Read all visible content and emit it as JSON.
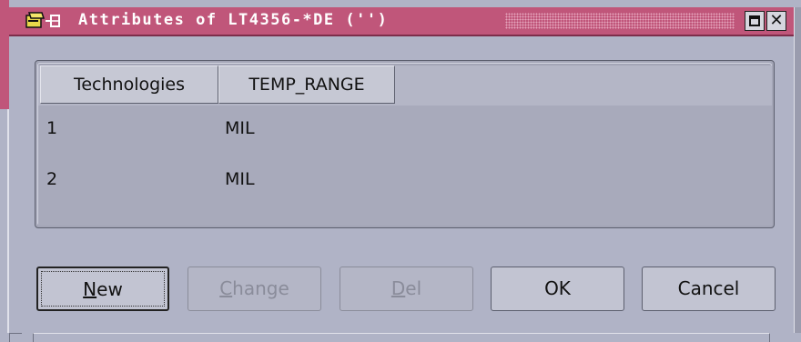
{
  "window": {
    "title": "Attributes of LT4356-*DE ('')",
    "controls": {
      "maximize_icon": "maximize-icon",
      "close_icon": "close-icon",
      "close_glyph": "✕"
    },
    "accent_color": "#c0567a"
  },
  "table": {
    "columns": [
      "Technologies",
      "TEMP_RANGE"
    ],
    "rows": [
      {
        "index": "1",
        "temp_range": "MIL"
      },
      {
        "index": "2",
        "temp_range": "MIL"
      }
    ]
  },
  "buttons": {
    "new": {
      "label": "New",
      "mnemonic": "N",
      "rest": "ew",
      "enabled": true,
      "focused": true
    },
    "change": {
      "label": "Change",
      "mnemonic": "C",
      "rest": "hange",
      "enabled": false
    },
    "del": {
      "label": "Del",
      "mnemonic": "D",
      "rest": "el",
      "enabled": false
    },
    "ok": {
      "label": "OK",
      "enabled": true
    },
    "cancel": {
      "label": "Cancel",
      "enabled": true
    }
  }
}
